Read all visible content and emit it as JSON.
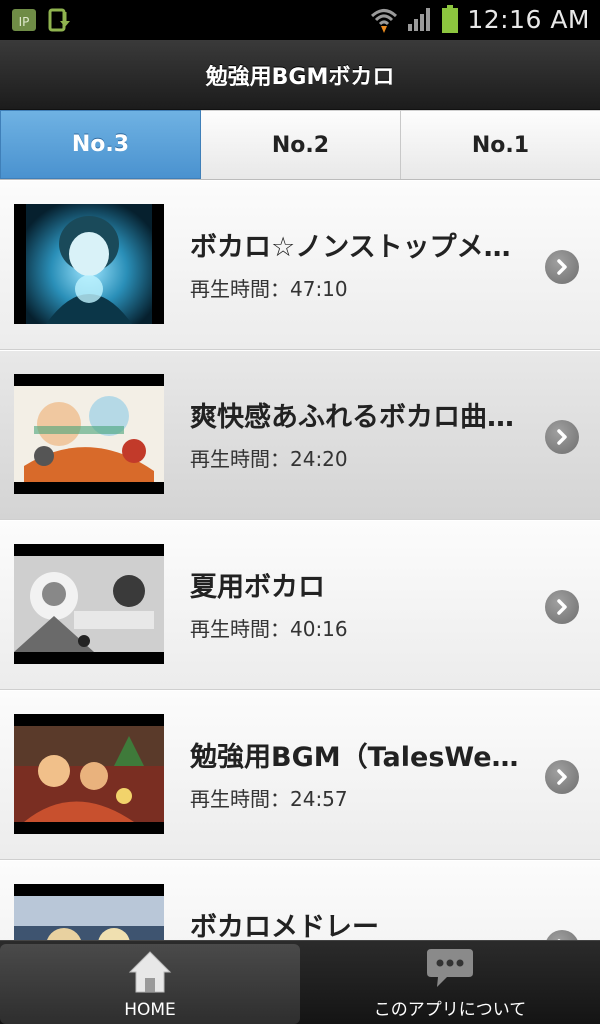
{
  "status_bar": {
    "time": "12:16 AM",
    "icons": [
      "ip-icon",
      "download-icon",
      "wifi-icon",
      "signal-icon",
      "battery-icon"
    ]
  },
  "header": {
    "title": "勉強用BGMボカロ"
  },
  "tabs": [
    {
      "label": "No.3",
      "active": true
    },
    {
      "label": "No.2",
      "active": false
    },
    {
      "label": "No.1",
      "active": false
    }
  ],
  "list": {
    "items": [
      {
        "title": "ボカロ☆ノンストップメドレー",
        "duration": "再生時間：47:10"
      },
      {
        "title": "爽快感あふれるボカロ曲メドレー",
        "duration": "再生時間：24:20"
      },
      {
        "title": "夏用ボカロ",
        "duration": "再生時間：40:16"
      },
      {
        "title": "勉強用BGM（TalesWeaver）",
        "duration": "再生時間：24:57"
      },
      {
        "title": "ボカロメドレー",
        "duration": ""
      }
    ]
  },
  "bottom_nav": [
    {
      "label": "HOME",
      "icon": "home-icon",
      "active": true
    },
    {
      "label": "このアプリについて",
      "icon": "chat-bubble-icon",
      "active": false
    }
  ],
  "colors": {
    "accent_tab": "#4a92cf",
    "header_bg": "#1c1c1c",
    "chevron": "#777777"
  }
}
